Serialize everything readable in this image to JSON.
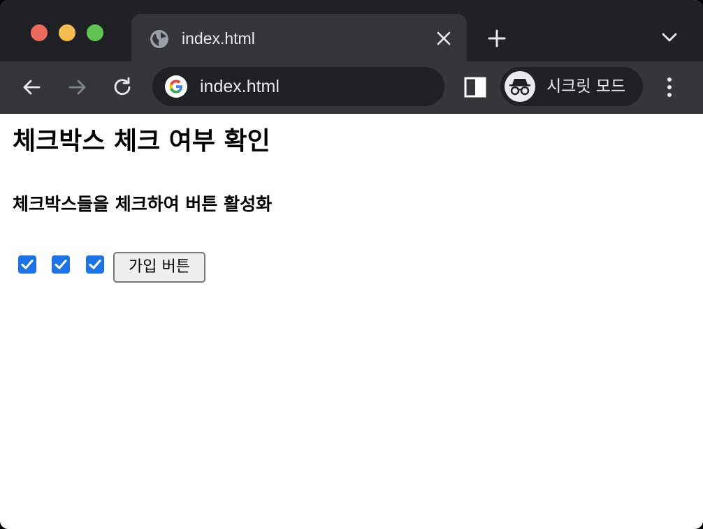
{
  "browser": {
    "tab": {
      "title": "index.html",
      "favicon": "globe-icon"
    },
    "address_bar": {
      "text": "index.html",
      "icon": "google-icon"
    },
    "profile": {
      "label": "시크릿 모드",
      "icon": "incognito-icon"
    },
    "colors": {
      "tabstrip": "#202124",
      "toolbar": "#35363a",
      "text": "#e8eaed"
    }
  },
  "page": {
    "heading": "체크박스 체크 여부 확인",
    "subheading": "체크박스들을 체크하여 버튼 활성화",
    "checkboxes": [
      {
        "checked": true
      },
      {
        "checked": true
      },
      {
        "checked": true
      }
    ],
    "button_label": "가입 버튼",
    "accent": "#1a73e8"
  }
}
